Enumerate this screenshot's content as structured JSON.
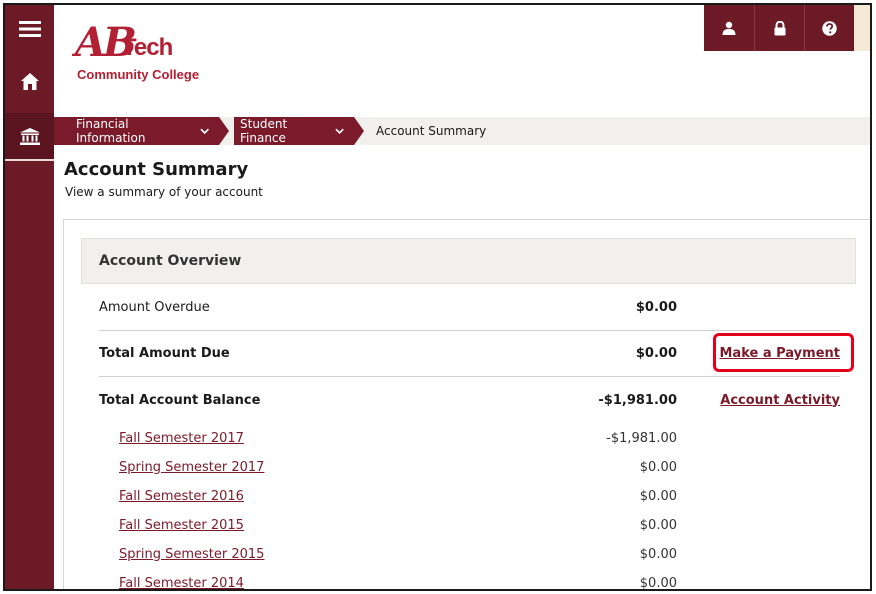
{
  "header": {
    "logo_ab": "AB",
    "logo_tech": "Tech",
    "logo_subtitle": "Community College"
  },
  "rail": {
    "items": [
      {
        "icon": "menu-icon"
      },
      {
        "icon": "home-icon"
      },
      {
        "icon": "bank-icon"
      }
    ]
  },
  "toolbar": {
    "icons": [
      "user-icon",
      "lock-icon",
      "help-icon"
    ]
  },
  "breadcrumb": {
    "items": [
      {
        "label": "Financial Information"
      },
      {
        "label": "Student Finance"
      }
    ],
    "current": "Account Summary"
  },
  "page": {
    "title": "Account Summary",
    "subtitle": "View a summary of your account"
  },
  "overview": {
    "heading": "Account Overview",
    "rows": [
      {
        "label": "Amount Overdue",
        "amount": "$0.00",
        "action": ""
      },
      {
        "label": "Total Amount Due",
        "amount": "$0.00",
        "action": "Make a Payment"
      },
      {
        "label": "Total Account Balance",
        "amount": "-$1,981.00",
        "action": "Account Activity"
      }
    ],
    "terms": [
      {
        "label": "Fall Semester 2017",
        "amount": "-$1,981.00"
      },
      {
        "label": "Spring Semester 2017",
        "amount": "$0.00"
      },
      {
        "label": "Fall Semester 2016",
        "amount": "$0.00"
      },
      {
        "label": "Fall Semester 2015",
        "amount": "$0.00"
      },
      {
        "label": "Spring Semester 2015",
        "amount": "$0.00"
      },
      {
        "label": "Fall Semester 2014",
        "amount": "$0.00"
      }
    ]
  },
  "colors": {
    "brand": "#6b1a26",
    "link": "#7a1a2a",
    "highlight": "#e3001b"
  }
}
